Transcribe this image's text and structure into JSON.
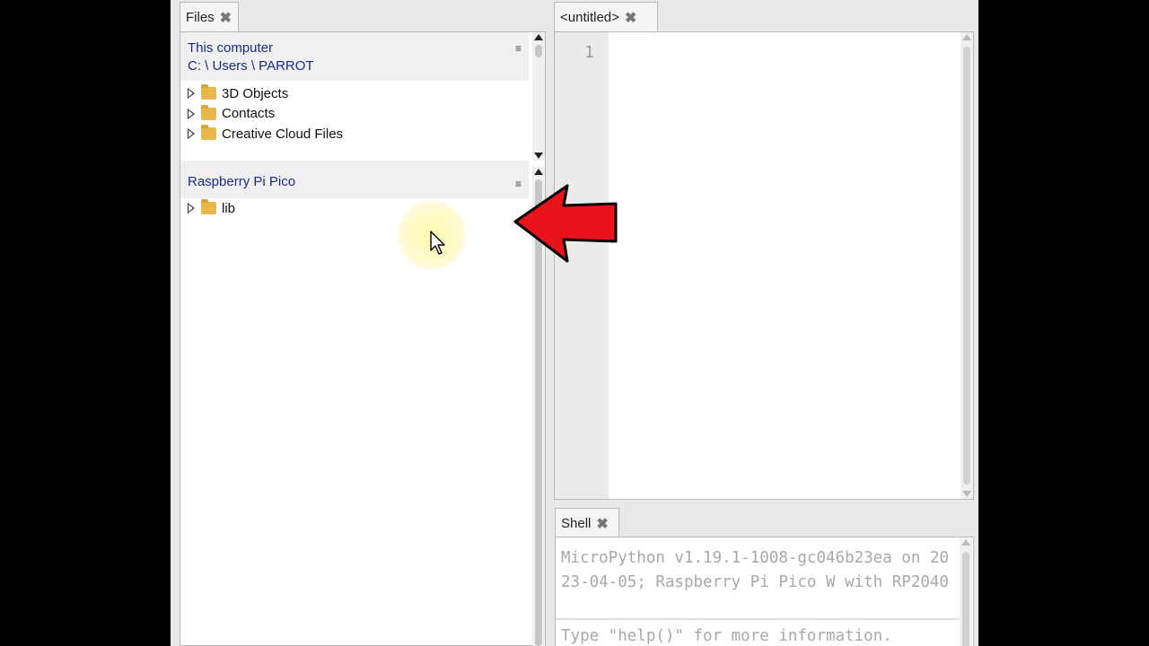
{
  "files_panel": {
    "tab_label": "Files",
    "close_glyph": "✖",
    "computer_section": {
      "title": "This computer",
      "path": "C: \\ Users \\ PARROT",
      "menu_icon": "hamburger-icon",
      "items": [
        {
          "label": "3D Objects"
        },
        {
          "label": "Contacts"
        },
        {
          "label": "Creative Cloud Files"
        }
      ]
    },
    "pico_section": {
      "title": "Raspberry Pi Pico",
      "menu_icon": "hamburger-icon",
      "items": [
        {
          "label": "lib"
        }
      ]
    }
  },
  "editor": {
    "tab_label": "<untitled>",
    "close_glyph": "✖",
    "line_number": "1"
  },
  "shell": {
    "tab_label": "Shell",
    "close_glyph": "✖",
    "banner": "MicroPython v1.19.1-1008-gc046b23ea on 2023-04-05; Raspberry Pi Pico W with RP2040",
    "help_line": "Type \"help()\" for more information."
  },
  "annotation": {
    "arrow_color": "#e8141c",
    "highlight_color": "#fff8b0"
  }
}
